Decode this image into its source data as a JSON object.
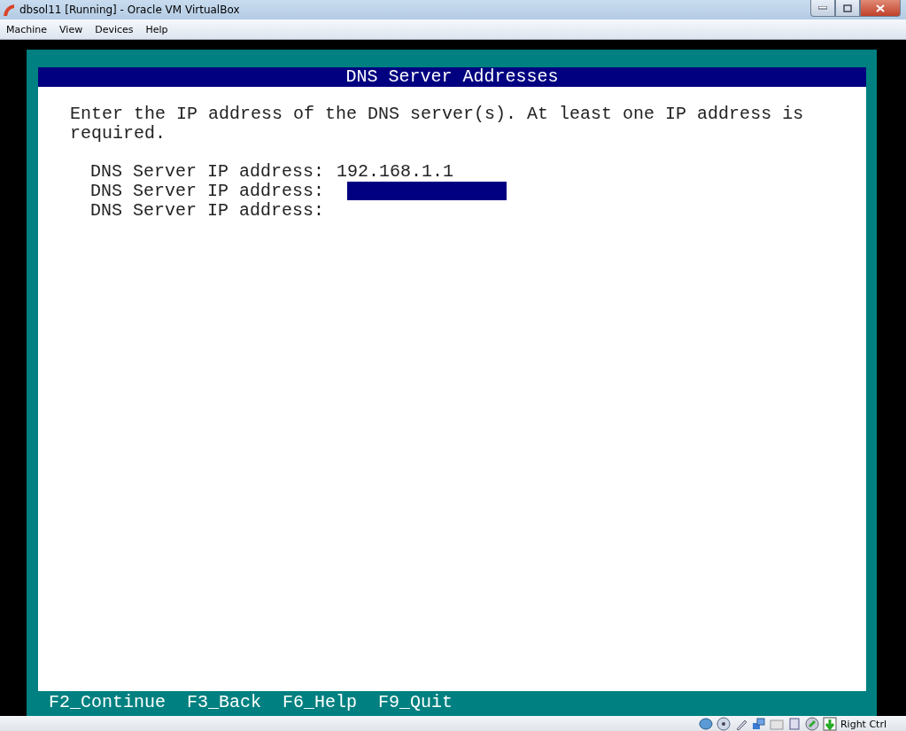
{
  "window": {
    "title": "dbsol11 [Running] - Oracle VM VirtualBox"
  },
  "menu": [
    "Machine",
    "View",
    "Devices",
    "Help"
  ],
  "screen": {
    "title": "DNS Server Addresses",
    "instructions": "Enter the IP address of the DNS server(s). At least one IP address is required.",
    "fields": [
      {
        "label": "DNS Server IP address:",
        "value": "192.168.1.1",
        "focused": false
      },
      {
        "label": "DNS Server IP address:",
        "focused": true
      },
      {
        "label": "DNS Server IP address:",
        "focused": false
      }
    ],
    "function_keys": [
      "F2_Continue",
      "F3_Back",
      "F6_Help",
      "F9_Quit"
    ]
  },
  "status_bar": {
    "host_key": "Right Ctrl"
  }
}
